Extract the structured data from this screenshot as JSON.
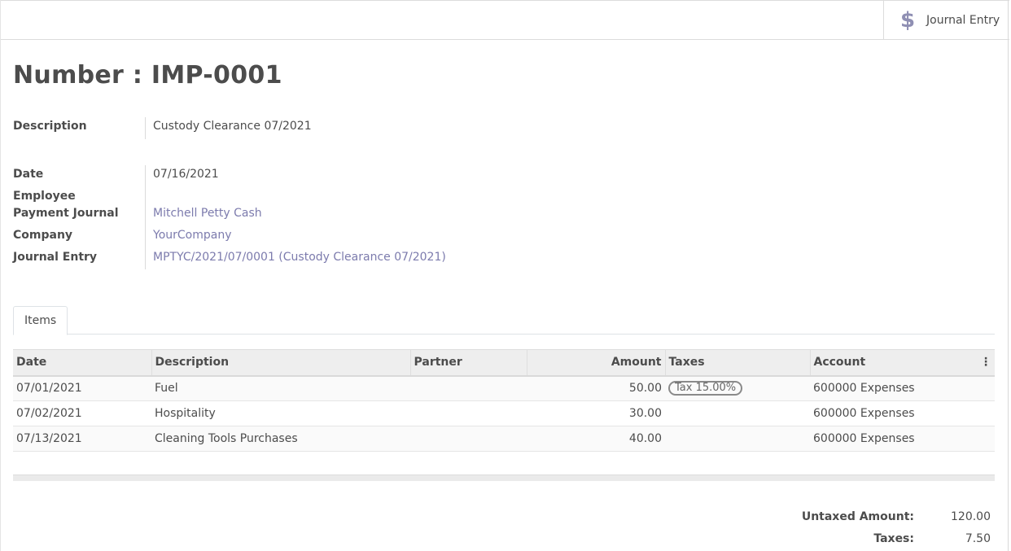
{
  "smart_button": {
    "icon": "dollar-icon",
    "label": "Journal Entry"
  },
  "title": "Number : IMP-0001",
  "fields": {
    "description": {
      "label": "Description",
      "value": "Custody Clearance 07/2021"
    },
    "date": {
      "label": "Date",
      "value": "07/16/2021"
    },
    "employee": {
      "label": "Employee",
      "value": ""
    },
    "payment_journal": {
      "label": "Payment Journal",
      "value": "Mitchell Petty Cash"
    },
    "company": {
      "label": "Company",
      "value": "YourCompany"
    },
    "journal_entry": {
      "label": "Journal Entry",
      "value": "MPTYC/2021/07/0001 (Custody Clearance 07/2021)"
    }
  },
  "tabs": [
    {
      "label": "Items"
    }
  ],
  "table": {
    "columns": [
      "Date",
      "Description",
      "Partner",
      "Amount",
      "Taxes",
      "Account"
    ],
    "rows": [
      {
        "date": "07/01/2021",
        "description": "Fuel",
        "partner": "",
        "amount": "50.00",
        "taxes": "Tax 15.00%",
        "account": "600000 Expenses"
      },
      {
        "date": "07/02/2021",
        "description": "Hospitality",
        "partner": "",
        "amount": "30.00",
        "taxes": "",
        "account": "600000 Expenses"
      },
      {
        "date": "07/13/2021",
        "description": "Cleaning Tools Purchases",
        "partner": "",
        "amount": "40.00",
        "taxes": "",
        "account": "600000 Expenses"
      }
    ]
  },
  "totals": {
    "untaxed_label": "Untaxed Amount:",
    "untaxed_value": "120.00",
    "taxes_label": "Taxes:",
    "taxes_value": "7.50"
  },
  "colors": {
    "link": "#7c7bad",
    "icon": "#8f8fb3"
  }
}
